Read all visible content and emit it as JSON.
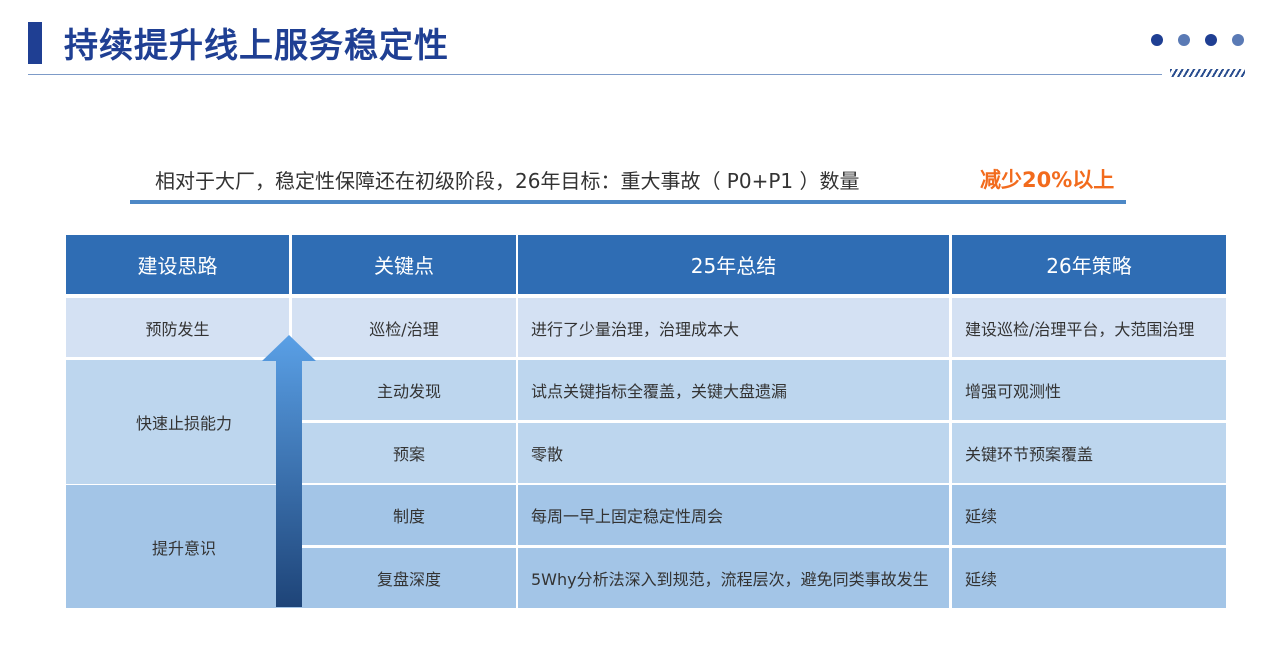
{
  "header": {
    "title": "持续提升线上服务稳定性",
    "dots": [
      "#1f3f93",
      "#5a7ab5",
      "#1f3f93",
      "#5a7ab5"
    ]
  },
  "subtitle": {
    "text": "相对于大厂，稳定性保障还在初级阶段，26年目标：重大事故（ P0+P1 ）数量",
    "highlight": "减少20%以上"
  },
  "table": {
    "headers": [
      "建设思路",
      "关键点",
      "25年总结",
      "26年策略"
    ],
    "groups": [
      "预防发生",
      "快速止损能力",
      "提升意识"
    ],
    "rows": [
      [
        "巡检/治理",
        "进行了少量治理，治理成本大",
        "建设巡检/治理平台，大范围治理"
      ],
      [
        "主动发现",
        "试点关键指标全覆盖，关键大盘遗漏",
        "增强可观测性"
      ],
      [
        "预案",
        "零散",
        "关键环节预案覆盖"
      ],
      [
        "制度",
        "每周一早上固定稳定性周会",
        "延续"
      ],
      [
        "复盘深度",
        "5Why分析法深入到规范，流程层次，避免同类事故发生",
        "延续"
      ]
    ]
  },
  "colors": {
    "brand": "#1f3f93",
    "accent": "#f26b1d",
    "header_bg": "#2f6db4",
    "row_light": "#d4e1f3",
    "row_mid": "#bdd6ee",
    "row_dark": "#a3c5e7"
  },
  "icons": {
    "arrow": "up-arrow-icon"
  }
}
